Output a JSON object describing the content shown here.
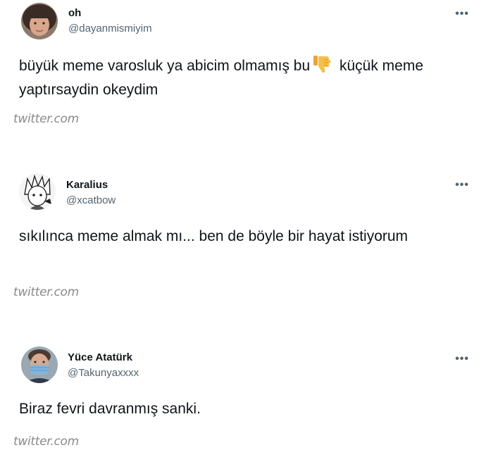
{
  "tweets": [
    {
      "name": "oh",
      "handle": "@dayanmismiyim",
      "more_icon": "more-horizontal-icon",
      "text_part1": "büyük meme varosluk ya abicim olmamış bu",
      "emoji": "thumbs-down-emoji",
      "text_part2": " küçük meme yaptırsaydin okeydim",
      "source": "twitter.com"
    },
    {
      "name": "Karalius",
      "handle": "@xcatbow",
      "more_icon": "more-horizontal-icon",
      "text": "sıkılınca meme almak mı... ben de böyle bir hayat istiyorum",
      "source": "twitter.com"
    },
    {
      "name": "Yüce Atatürk",
      "handle": "@Takunyaxxxx",
      "more_icon": "more-horizontal-icon",
      "text": "Biraz fevri davranmış sanki.",
      "source": "twitter.com"
    }
  ],
  "more_label": "•••"
}
